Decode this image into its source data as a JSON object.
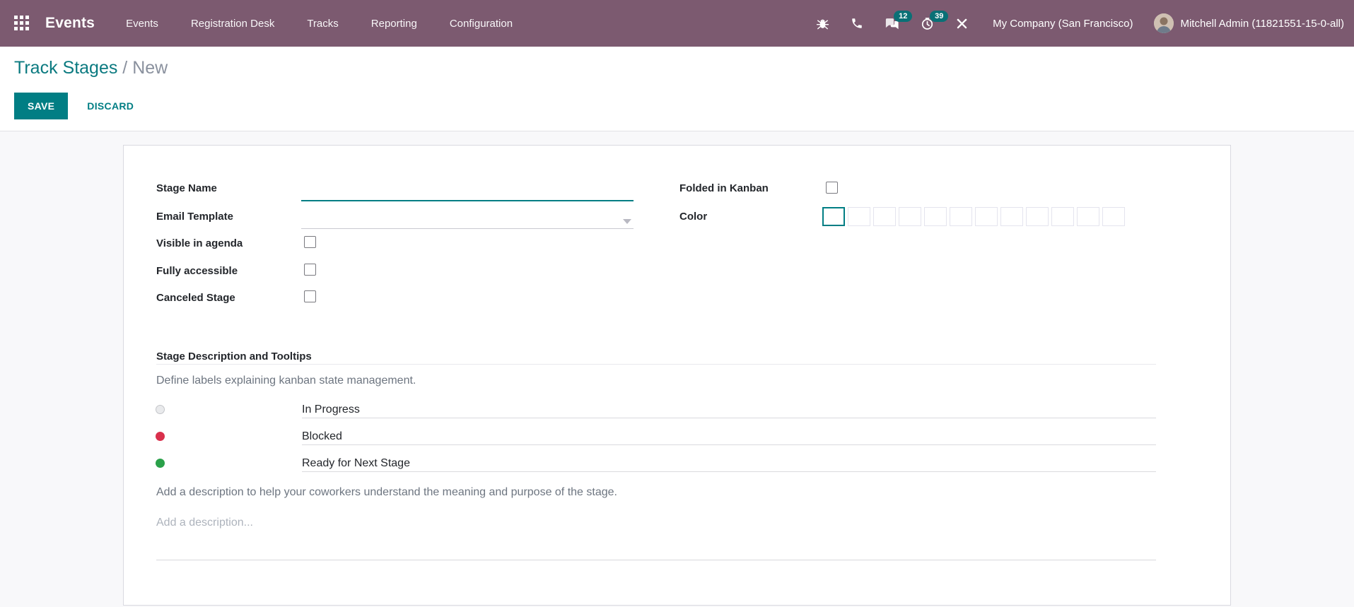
{
  "navbar": {
    "app_name": "Events",
    "menu": [
      "Events",
      "Registration Desk",
      "Tracks",
      "Reporting",
      "Configuration"
    ],
    "badges": {
      "messages": "12",
      "activities": "39"
    },
    "company": "My Company (San Francisco)",
    "user": "Mitchell Admin (11821551-15-0-all)"
  },
  "breadcrumb": {
    "parent": "Track Stages",
    "separator": " / ",
    "current": "New"
  },
  "actions": {
    "save": "SAVE",
    "discard": "DISCARD"
  },
  "form": {
    "stage_name": {
      "label": "Stage Name",
      "value": ""
    },
    "email_template": {
      "label": "Email Template",
      "value": ""
    },
    "visible_in_agenda": {
      "label": "Visible in agenda",
      "checked": false
    },
    "fully_accessible": {
      "label": "Fully accessible",
      "checked": false
    },
    "canceled_stage": {
      "label": "Canceled Stage",
      "checked": false
    },
    "folded_in_kanban": {
      "label": "Folded in Kanban",
      "checked": false
    },
    "color": {
      "label": "Color",
      "selected": "none",
      "swatches": [
        "none",
        "#F06050",
        "#F4A460",
        "#F7CD1F",
        "#6CC1ED",
        "#814968",
        "#EB7E7F",
        "#2C8397",
        "#475577",
        "#D6145F",
        "#30C381",
        "#9365B8"
      ]
    }
  },
  "section": {
    "title": "Stage Description and Tooltips",
    "help": "Define labels explaining kanban state management.",
    "kanban_states": [
      {
        "label": "In Progress",
        "color": "#e9eaec"
      },
      {
        "label": "Blocked",
        "color": "#d9304c"
      },
      {
        "label": "Ready for Next Stage",
        "color": "#2aa14a"
      }
    ],
    "description_help": "Add a description to help your coworkers understand the meaning and purpose of the stage.",
    "description_placeholder": "Add a description..."
  },
  "theme": {
    "navbar_bg": "#7c5a70",
    "accent": "#017e84",
    "badge_bg": "#0a7076",
    "page_bg": "#f8f8fa"
  }
}
